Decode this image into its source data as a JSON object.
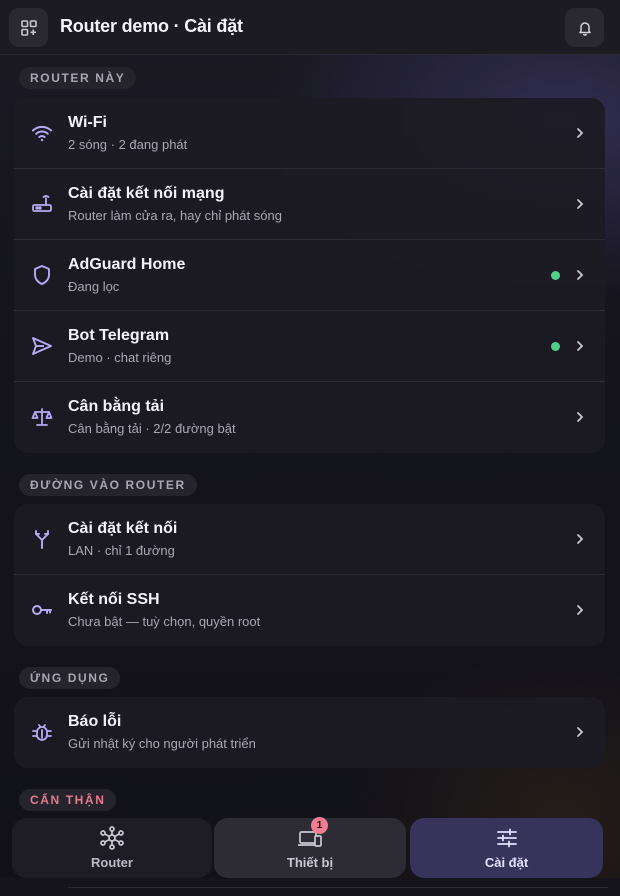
{
  "header": {
    "title": "Router demo · Cài đặt"
  },
  "sections": [
    {
      "label": "ROUTER NÀY",
      "items": [
        {
          "title": "Wi-Fi",
          "subtitle": "2 sóng · 2 đang phát",
          "icon": "wifi-icon",
          "status_dot": false
        },
        {
          "title": "Cài đặt kết nối mạng",
          "subtitle": "Router làm cửa ra, hay chỉ phát sóng",
          "icon": "router-icon",
          "status_dot": false
        },
        {
          "title": "AdGuard Home",
          "subtitle": "Đang lọc",
          "icon": "shield-icon",
          "status_dot": true
        },
        {
          "title": "Bot Telegram",
          "subtitle": "Demo · chat riêng",
          "icon": "send-icon",
          "status_dot": true
        },
        {
          "title": "Cân bằng tải",
          "subtitle": "Cân bằng tải · 2/2 đường bật",
          "icon": "balance-scale-icon",
          "status_dot": false
        }
      ]
    },
    {
      "label": "ĐƯỜNG VÀO ROUTER",
      "items": [
        {
          "title": "Cài đặt kết nối",
          "subtitle": "LAN · chỉ 1 đường",
          "icon": "fork-icon",
          "status_dot": false
        },
        {
          "title": "Kết nối SSH",
          "subtitle": "Chưa bật — tuỳ chọn, quyền root",
          "icon": "key-icon",
          "status_dot": false
        }
      ]
    },
    {
      "label": "ỨNG DỤNG",
      "items": [
        {
          "title": "Báo lỗi",
          "subtitle": "Gửi nhật ký cho người phát triển",
          "icon": "bug-icon",
          "status_dot": false
        }
      ]
    },
    {
      "label": "CẨN THẬN",
      "items": []
    }
  ],
  "nav": [
    {
      "label": "Router",
      "icon": "network-hub-icon",
      "active": false
    },
    {
      "label": "Thiết bị",
      "icon": "devices-icon",
      "active": false,
      "badge": "1"
    },
    {
      "label": "Cài đặt",
      "icon": "sliders-icon",
      "active": true
    }
  ],
  "colors": {
    "accent": "#b8a9f5",
    "status_green": "#4fd08a",
    "danger_label": "#e57a8c",
    "badge": "#f07d92",
    "active_tab": "#37335a"
  }
}
